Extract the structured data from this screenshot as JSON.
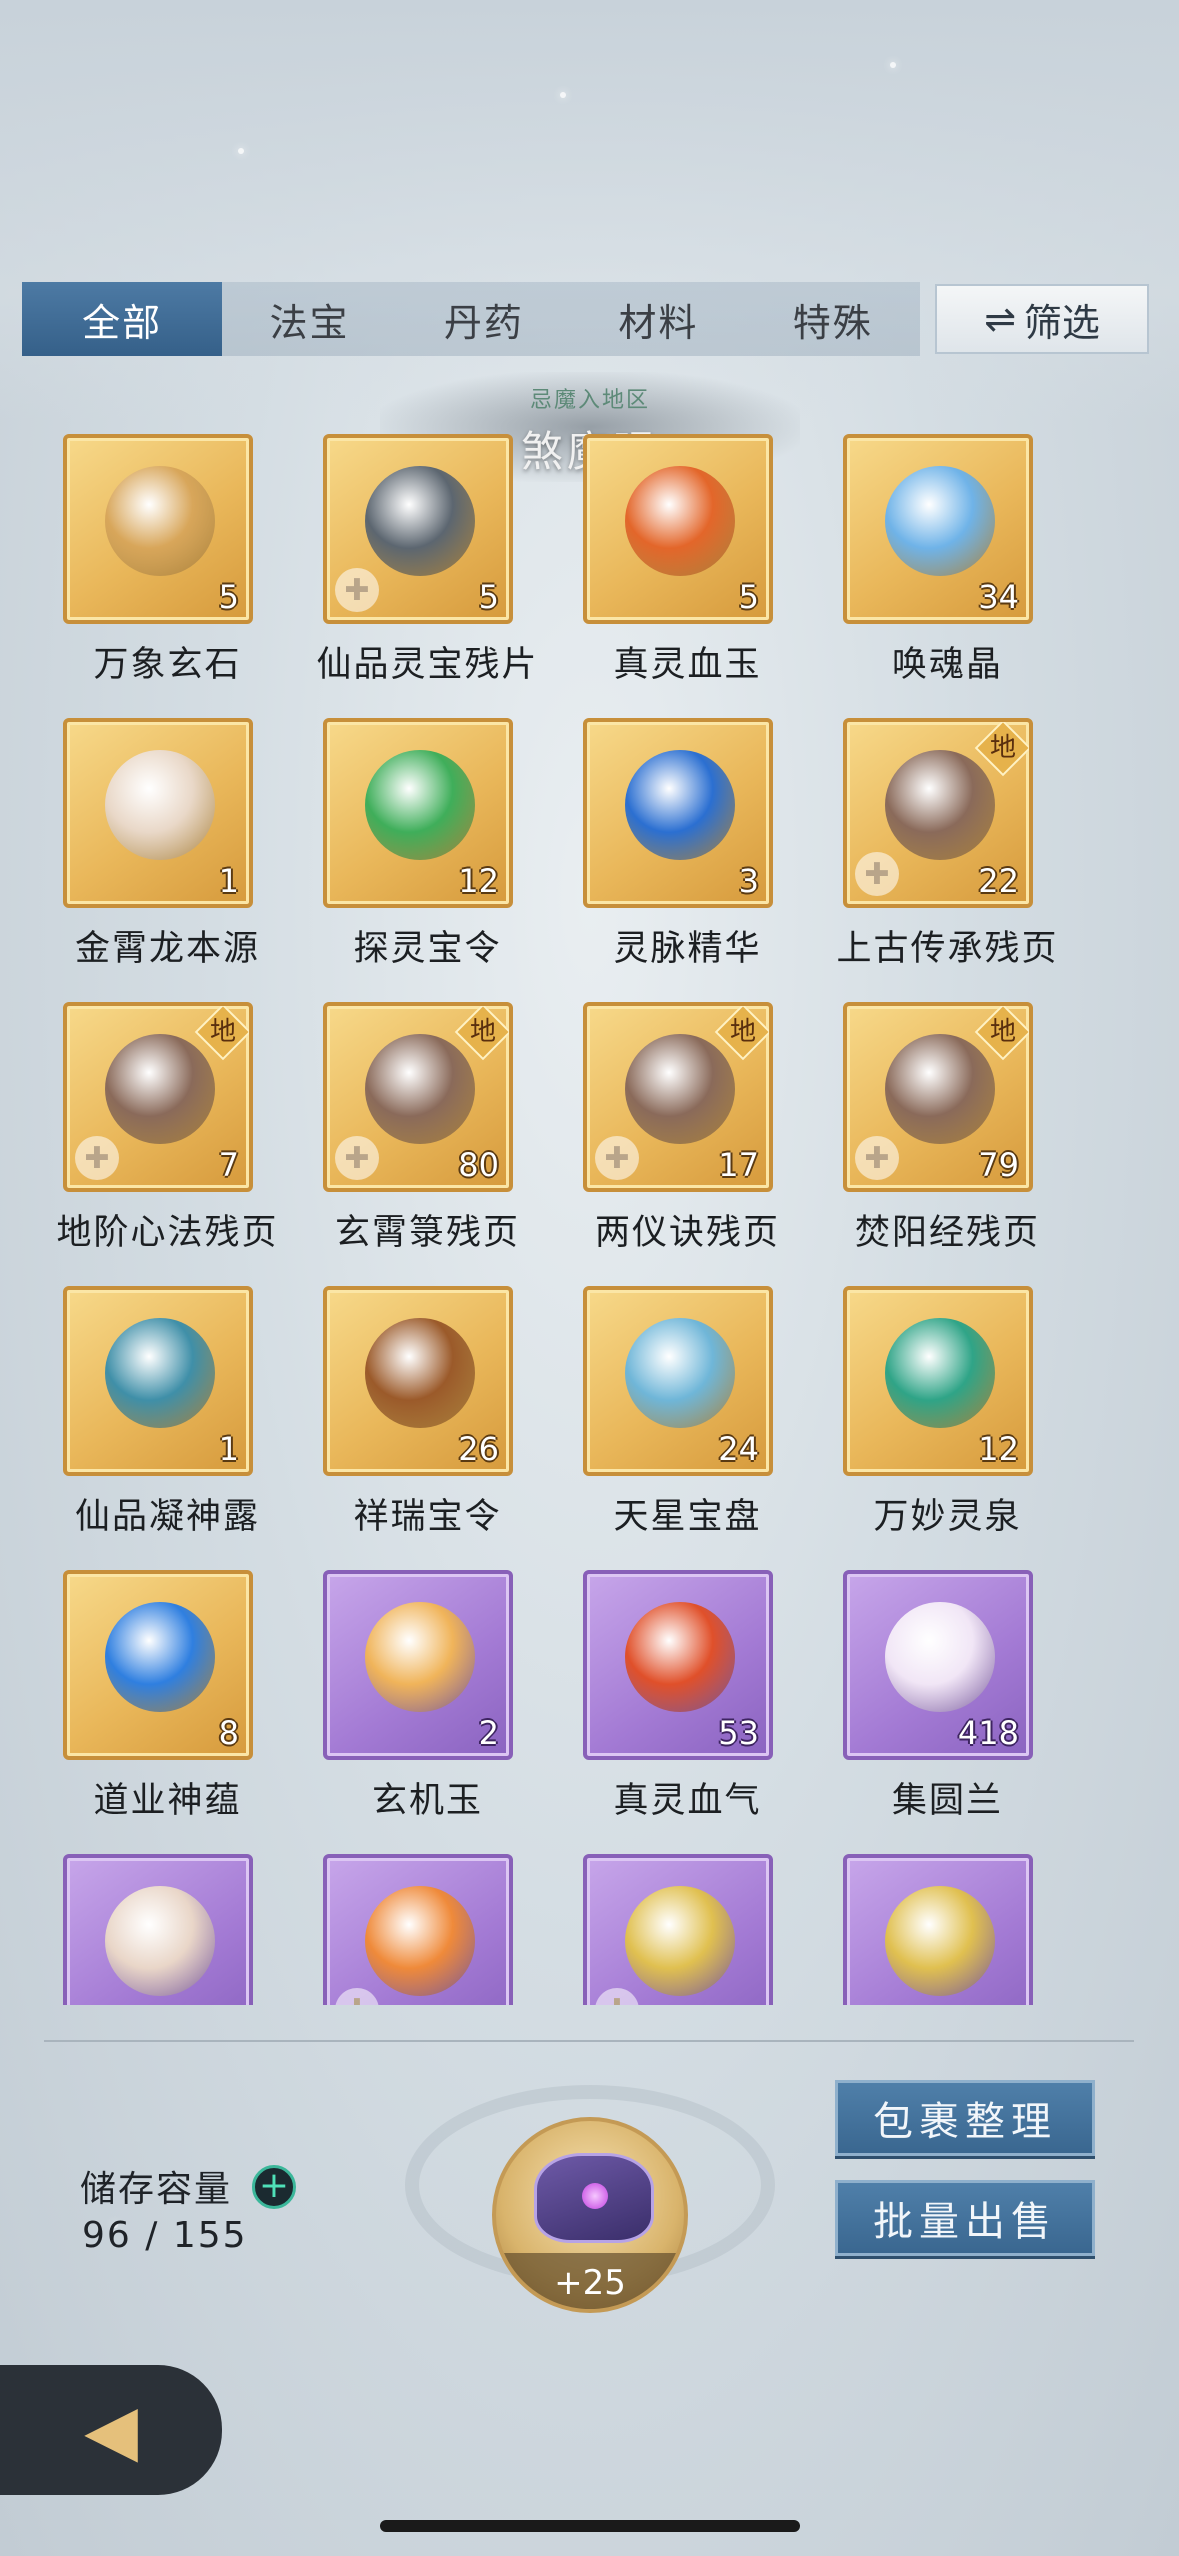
{
  "tabs": [
    {
      "label": "全部",
      "active": true
    },
    {
      "label": "法宝",
      "active": false
    },
    {
      "label": "丹药",
      "active": false
    },
    {
      "label": "材料",
      "active": false
    },
    {
      "label": "特殊",
      "active": false
    }
  ],
  "filter_button": {
    "label": "筛选",
    "icon": "swap-arrows-icon"
  },
  "location": {
    "subtitle": "忌魔入地区",
    "title": "煞魔眼"
  },
  "items": [
    {
      "name": "万象玄石",
      "count": "5",
      "rarity": "gold",
      "art_color": "#d8a65a"
    },
    {
      "name": "仙品灵宝残片",
      "count": "5",
      "rarity": "gold",
      "art_color": "#5c6670",
      "puzzle": true
    },
    {
      "name": "真灵血玉",
      "count": "5",
      "rarity": "gold",
      "art_color": "#e3662a"
    },
    {
      "name": "唤魂晶",
      "count": "34",
      "rarity": "gold",
      "art_color": "#6fb3e8"
    },
    {
      "name": "金霄龙本源",
      "count": "1",
      "rarity": "gold",
      "art_color": "#e9d8c8"
    },
    {
      "name": "探灵宝令",
      "count": "12",
      "rarity": "gold",
      "art_color": "#3fae5a"
    },
    {
      "name": "灵脉精华",
      "count": "3",
      "rarity": "gold",
      "art_color": "#2b6fd1"
    },
    {
      "name": "上古传承残页",
      "count": "22",
      "rarity": "gold",
      "art_color": "#8a6a5a",
      "badge": "地",
      "puzzle": true
    },
    {
      "name": "地阶心法残页",
      "count": "7",
      "rarity": "gold",
      "art_color": "#8a6a5a",
      "badge": "地",
      "puzzle": true
    },
    {
      "name": "玄霄箓残页",
      "count": "80",
      "rarity": "gold",
      "art_color": "#8a6a5a",
      "badge": "地",
      "puzzle": true
    },
    {
      "name": "两仪诀残页",
      "count": "17",
      "rarity": "gold",
      "art_color": "#8a6a5a",
      "badge": "地",
      "puzzle": true
    },
    {
      "name": "焚阳经残页",
      "count": "79",
      "rarity": "gold",
      "art_color": "#8a6a5a",
      "badge": "地",
      "puzzle": true
    },
    {
      "name": "仙品凝神露",
      "count": "1",
      "rarity": "gold",
      "art_color": "#3f8fa8"
    },
    {
      "name": "祥瑞宝令",
      "count": "26",
      "rarity": "gold",
      "art_color": "#9b5a2a"
    },
    {
      "name": "天星宝盘",
      "count": "24",
      "rarity": "gold",
      "art_color": "#6fb6d8"
    },
    {
      "name": "万妙灵泉",
      "count": "12",
      "rarity": "gold",
      "art_color": "#2fa487"
    },
    {
      "name": "道业神蕴",
      "count": "8",
      "rarity": "gold",
      "art_color": "#2f7fe0"
    },
    {
      "name": "玄机玉",
      "count": "2",
      "rarity": "purple",
      "art_color": "#f0b45a"
    },
    {
      "name": "真灵血气",
      "count": "53",
      "rarity": "purple",
      "art_color": "#e0502a"
    },
    {
      "name": "集圆兰",
      "count": "418",
      "rarity": "purple",
      "art_color": "#f1e6f6"
    },
    {
      "name": "",
      "count": "",
      "rarity": "purple",
      "art_color": "#e9d6c8"
    },
    {
      "name": "",
      "count": "",
      "rarity": "purple",
      "art_color": "#ef8a3a",
      "puzzle": true
    },
    {
      "name": "",
      "count": "",
      "rarity": "purple",
      "art_color": "#e0c050",
      "puzzle": true
    },
    {
      "name": "",
      "count": "",
      "rarity": "purple",
      "art_color": "#e0c050"
    }
  ],
  "storage": {
    "label": "储存容量",
    "value": "96 / 155"
  },
  "center_orb": {
    "bonus": "+25"
  },
  "buttons": {
    "organize": "包裹整理",
    "bulk_sell": "批量出售"
  }
}
